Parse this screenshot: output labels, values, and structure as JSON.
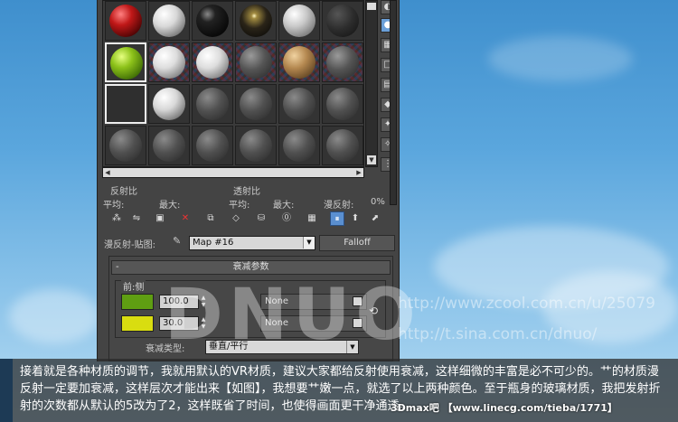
{
  "material_editor": {
    "labels": {
      "reflect_ratio": "反射比",
      "refract_ratio": "透射比",
      "avg1": "平均:",
      "max1": "最大:",
      "avg2": "平均:",
      "max2": "最大:",
      "diffuse_ratio": "漫反射:",
      "pct": "0%",
      "diffuse_map": "漫反射-贴图:",
      "map_name": "Map #16",
      "map_type": "Falloff"
    },
    "falloff_params": {
      "title": "衰减参数",
      "front_side": "前:侧",
      "rows": [
        {
          "color": "#5f9e12",
          "value": "100.0",
          "map": "None"
        },
        {
          "color": "#d9dd10",
          "value": "30.0",
          "map": "None"
        }
      ],
      "falloff_type_label": "衰减类型:",
      "falloff_type_value": "垂直/平行"
    },
    "slots": [
      [
        {
          "kind": "red"
        },
        {
          "kind": "white"
        },
        {
          "kind": "black-glossy"
        },
        {
          "kind": "dark-sparkle"
        },
        {
          "kind": "marble"
        },
        {
          "kind": "dark-metal"
        }
      ],
      [
        {
          "kind": "green"
        },
        {
          "kind": "white-checker"
        },
        {
          "kind": "white-checker"
        },
        {
          "kind": "grey-checker"
        },
        {
          "kind": "wood-checker"
        },
        {
          "kind": "grey-checker"
        }
      ],
      [
        {
          "kind": "selected-dark"
        },
        {
          "kind": "white"
        },
        {
          "kind": "grey"
        },
        {
          "kind": "grey"
        },
        {
          "kind": "grey"
        },
        {
          "kind": "grey"
        }
      ],
      [
        {
          "kind": "grey"
        },
        {
          "kind": "grey"
        },
        {
          "kind": "grey"
        },
        {
          "kind": "grey"
        },
        {
          "kind": "grey"
        },
        {
          "kind": "grey"
        }
      ]
    ]
  },
  "watermarks": {
    "logo": "DNUO",
    "url1": "http://www.zcool.com.cn/u/25079",
    "url2": "http://t.sina.com.cn/dnuo/"
  },
  "caption": {
    "text": "接着就是各种材质的调节，我就用默认的VR材质，建议大家都给反射使用衰减，这样细微的丰富是必不可少的。艹的材质漫反射一定要加衰减，这样层次才能出来【如图】，我想要艹嫩一点，就选了以上两种颜色。至于瓶身的玻璃材质，我把发射折射的次数都从默认的5改为了2，这样既省了时间，也使得画面更干净通透。",
    "credit": "3Dmax吧 【www.linecg.com/tieba/1771】"
  }
}
